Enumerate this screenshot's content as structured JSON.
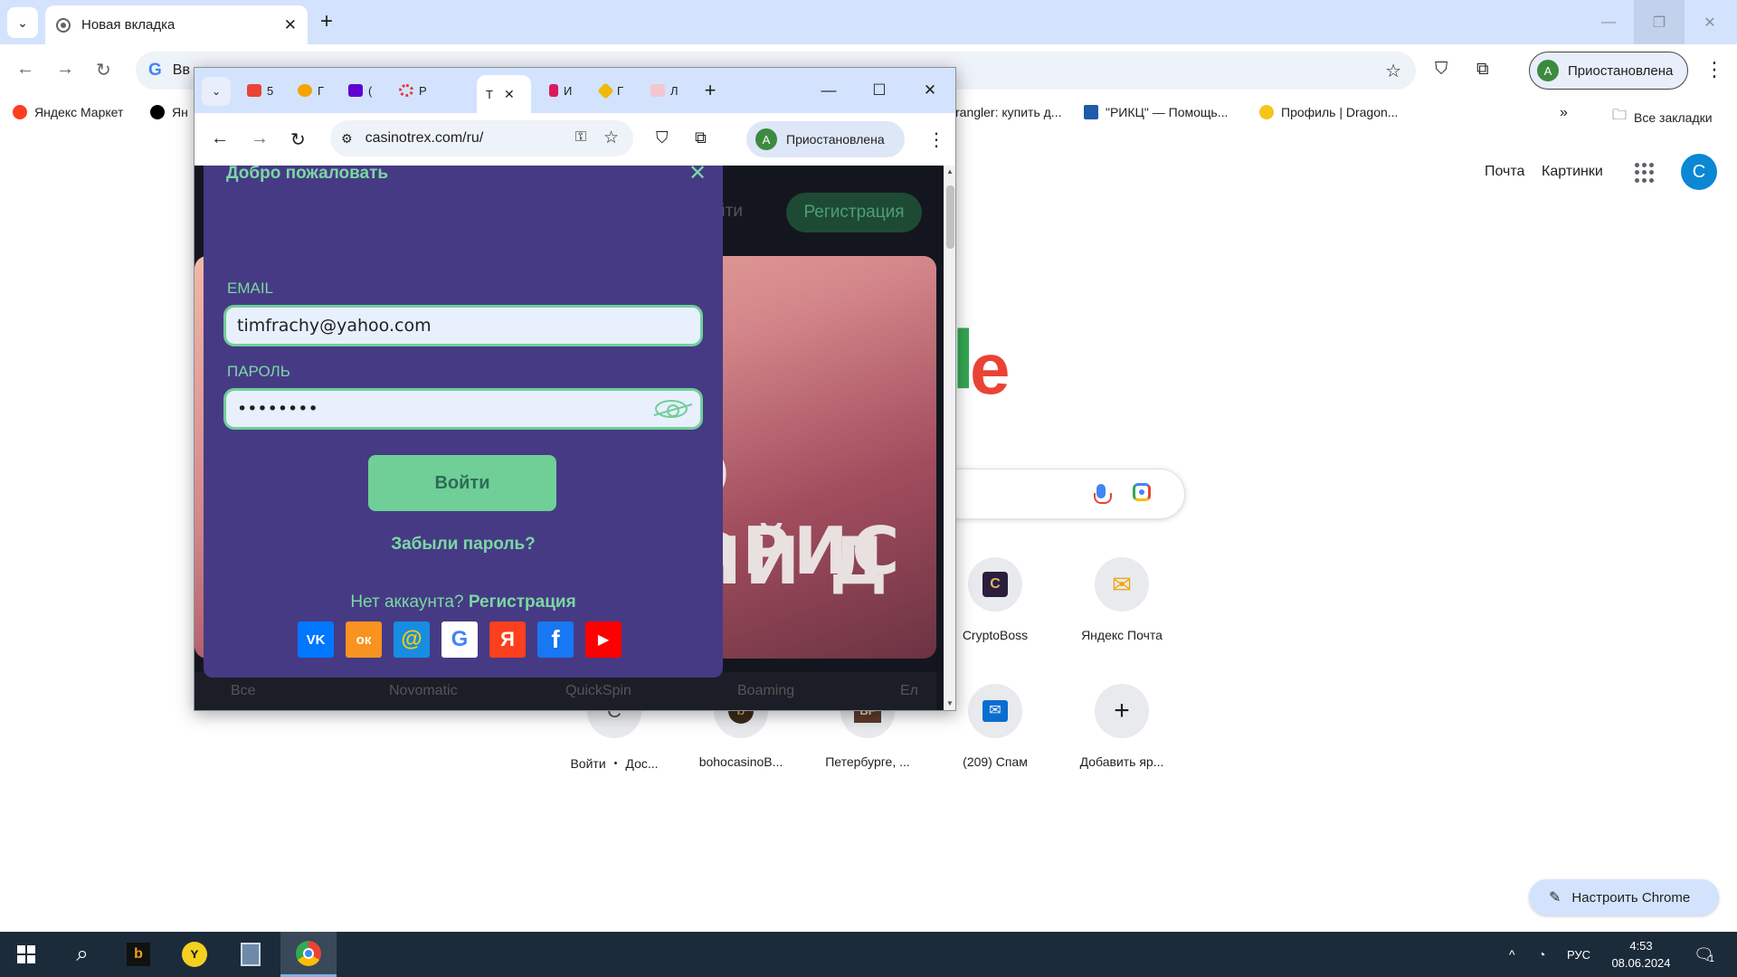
{
  "main_window": {
    "tab": {
      "title": "Новая вкладка"
    },
    "omnibox": {
      "text": "Вв"
    },
    "profile": {
      "avatar": "A",
      "status": "Приостановлена"
    },
    "bookmarks": [
      {
        "label": "Яндекс Маркет",
        "icon": "yandex-market-icon",
        "color": "#fc3f1d"
      },
      {
        "label": "Ян",
        "icon": "plus-icon",
        "color": "#000000"
      },
      {
        "label": "rangler: купить д...",
        "icon": "",
        "color": "#ffffff"
      },
      {
        "label": "\"РИКЦ\" — Помощь...",
        "icon": "rikc-icon",
        "color": "#1e5ba8"
      },
      {
        "label": "Профиль | Dragon...",
        "icon": "dragon-coin-icon",
        "color": "#f5c518"
      }
    ],
    "all_bookmarks": "Все закладки",
    "ntp": {
      "links": {
        "mail": "Почта",
        "images": "Картинки"
      },
      "account_initial": "C",
      "logo_tail": [
        "l",
        "e"
      ],
      "shortcuts_row1": [
        {
          "label": "CryptoBoss",
          "icon": "cryptoboss-icon",
          "glyph": "C"
        },
        {
          "label": "Яндекс Почта",
          "icon": "yandex-mail-icon",
          "glyph": "✉"
        }
      ],
      "shortcuts_row2": [
        {
          "label": "Войти ・ Дос...",
          "icon": "shortcut-c-icon",
          "glyph": "C"
        },
        {
          "label": "bohocasinoB...",
          "icon": "bohocasino-icon",
          "glyph": "b"
        },
        {
          "label": "Петербурге, ...",
          "icon": "bf-icon",
          "glyph": "BF"
        },
        {
          "label": "(209) Спам",
          "icon": "mail-spam-icon",
          "glyph": "✉"
        },
        {
          "label": "Добавить яр...",
          "icon": "add-shortcut-icon",
          "glyph": "+"
        }
      ],
      "customize": "Настроить Chrome"
    }
  },
  "popup_window": {
    "tabs": [
      {
        "label": "5",
        "icon": "gmail-icon",
        "color": "#ea4335"
      },
      {
        "label": "Г",
        "icon": "coin-icon",
        "color": "#f4a300"
      },
      {
        "label": "(",
        "icon": "yahoo-mail-icon",
        "color": "#6001d2"
      },
      {
        "label": "Р",
        "icon": "roulette-icon",
        "color": "#e53935"
      },
      {
        "label": "Т",
        "icon": "",
        "color": "#ffffff"
      },
      {
        "label": "И",
        "icon": "slot-icon",
        "color": "#d81b60"
      },
      {
        "label": "Г",
        "icon": "binance-icon",
        "color": "#f0b90b"
      },
      {
        "label": "Л",
        "icon": "flag-icon",
        "color": "#e57373"
      }
    ],
    "url": "casinotrex.com/ru/",
    "profile": {
      "avatar": "A",
      "status": "Приостановлена"
    },
    "site": {
      "register_button": "Регистрация",
      "login_partial": "йти",
      "banner_line1": "О ФРИС",
      "banner_line2": "ЫЙ Д",
      "categories": [
        "Все",
        "Novomatic",
        "QuickSpin",
        "Boaming",
        "Ел"
      ]
    },
    "login_modal": {
      "title": "Добро пожаловать",
      "email_label": "EMAIL",
      "email_value": "timfrachy@yahoo.com",
      "password_label": "ПАРОЛЬ",
      "password_value": "••••••••",
      "login_button": "Войти",
      "forgot_link": "Забыли пароль?",
      "no_account_text": "Нет аккаунта?",
      "register_link": "Регистрация",
      "socials": [
        {
          "name": "vk-icon",
          "glyph": "VK",
          "color": "#0077ff"
        },
        {
          "name": "odnoklassniki-icon",
          "glyph": "ок",
          "color": "#f7931e"
        },
        {
          "name": "mailru-icon",
          "glyph": "@",
          "color": "#168de2"
        },
        {
          "name": "google-icon",
          "glyph": "G",
          "color": "#ffffff"
        },
        {
          "name": "yandex-icon",
          "glyph": "Я",
          "color": "#fc3f1d"
        },
        {
          "name": "facebook-icon",
          "glyph": "f",
          "color": "#1877f2"
        },
        {
          "name": "youtube-icon",
          "glyph": "▶",
          "color": "#ff0000"
        }
      ]
    }
  },
  "taskbar": {
    "language": "РУС",
    "time": "4:53",
    "date": "08.06.2024",
    "notifications": "1"
  }
}
